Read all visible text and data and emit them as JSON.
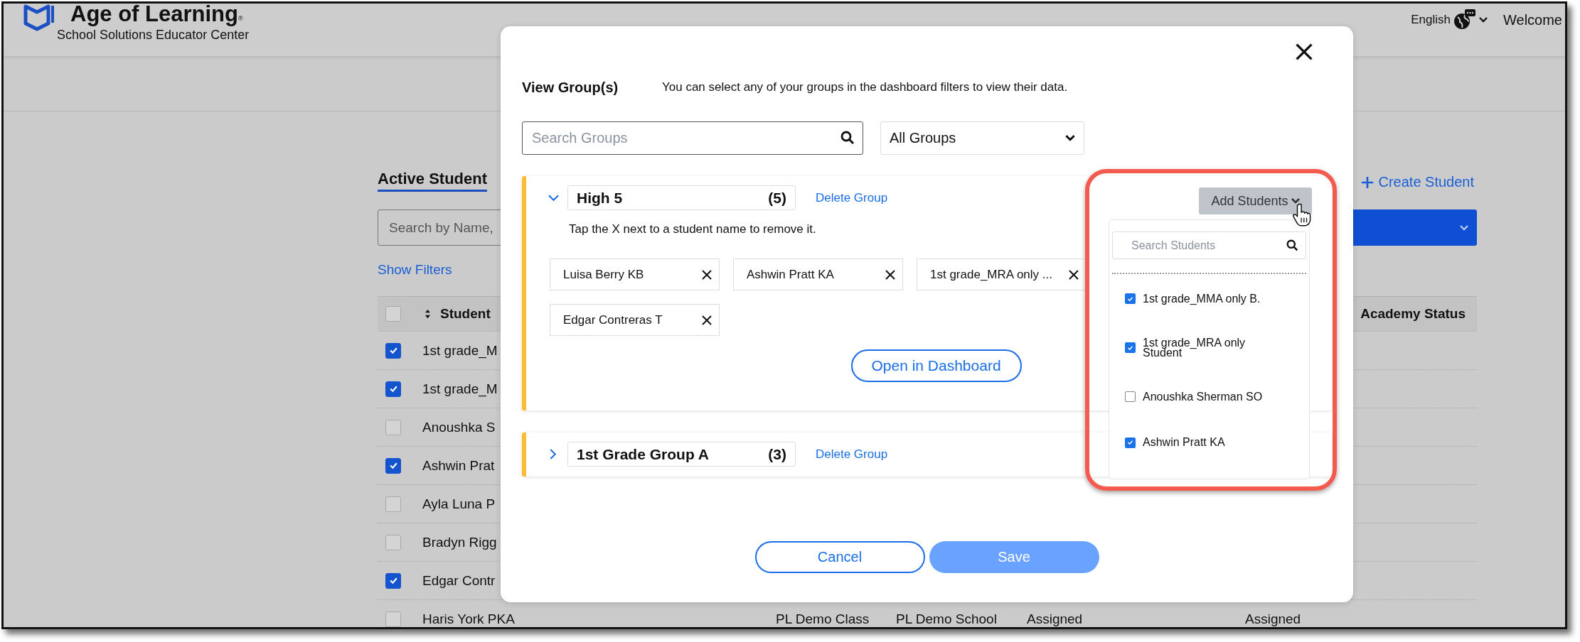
{
  "header": {
    "brand": "Age of Learning",
    "brand_mark": "®",
    "subtitle": "School Solutions Educator Center",
    "language": "English",
    "welcome": "Welcome"
  },
  "page": {
    "title": "Active Student",
    "search": {
      "placeholder": "Search by Name,"
    },
    "filters_link": "Show Filters",
    "create_button": "Create Student",
    "table": {
      "select_all_checked": false,
      "columns": [
        "Student",
        "Academy Status"
      ],
      "rows": [
        {
          "checked": true,
          "cells": [
            "1st grade_M"
          ]
        },
        {
          "checked": true,
          "cells": [
            "1st grade_M"
          ]
        },
        {
          "checked": false,
          "cells": [
            "Anoushka S"
          ]
        },
        {
          "checked": true,
          "cells": [
            "Ashwin Prat"
          ]
        },
        {
          "checked": false,
          "cells": [
            "Ayla Luna P"
          ]
        },
        {
          "checked": false,
          "cells": [
            "Bradyn Rigg"
          ]
        },
        {
          "checked": true,
          "cells": [
            "Edgar Contr"
          ]
        },
        {
          "checked": false,
          "cells": [
            "Haris York PKA",
            "PL Demo Class",
            "PL Demo School",
            "Assigned",
            "Assigned"
          ]
        }
      ]
    }
  },
  "dialog": {
    "title": "View Group(s)",
    "description": "You can select any of your groups in the dashboard filters to view their data.",
    "search": {
      "placeholder": "Search Groups"
    },
    "filter": {
      "value": "All Groups"
    },
    "groups": [
      {
        "name": "High 5",
        "count": "(5)",
        "expanded": true,
        "delete_link": "Delete Group",
        "hint": "Tap the X next to a student name to remove it.",
        "chip_rows": [
          [
            "Luisa Berry KB",
            "Ashwin Pratt KA",
            "1st grade_MRA only ..."
          ],
          [
            "Edgar Contreras T"
          ]
        ],
        "open_button": "Open in Dashboard"
      },
      {
        "name": "1st Grade Group A",
        "count": "(3)",
        "expanded": false,
        "delete_link": "Delete Group"
      }
    ],
    "buttons": {
      "cancel": "Cancel",
      "save": "Save"
    },
    "add_students": {
      "label": "Add Students",
      "search": {
        "placeholder": "Search Students"
      },
      "students": [
        {
          "name": "1st grade_MMA only B.",
          "checked": true
        },
        {
          "name": "1st grade_MRA only Student",
          "checked": true
        },
        {
          "name": "Anoushka Sherman SO",
          "checked": false
        },
        {
          "name": "Ashwin Pratt KA",
          "checked": true
        }
      ]
    }
  }
}
